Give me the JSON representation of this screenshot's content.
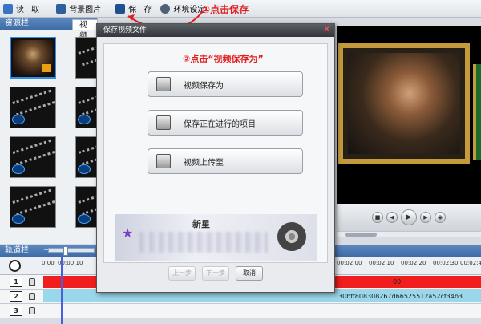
{
  "toolbar": {
    "read_label": "读 取",
    "bg_label": "背景图片",
    "save_label": "保 存",
    "env_label": "环境设定",
    "annotation1": "①点击保存"
  },
  "resource_panel": {
    "title": "资源栏",
    "tab": "视 频"
  },
  "dialog": {
    "title": "保存视频文件",
    "close": "x",
    "annotation2": "②点击“视频保存为”",
    "options": [
      {
        "label": "视频保存为"
      },
      {
        "label": "保存正在进行的项目"
      },
      {
        "label": "视频上传至"
      }
    ],
    "promo_title": "新星",
    "buttons": {
      "prev": "上一步",
      "next": "下一步",
      "cancel": "取消"
    }
  },
  "track_panel": {
    "title": "轨道栏",
    "ruler": [
      "0:00",
      "00:00:10",
      "00:02:00",
      "00:02:10",
      "00:02:20",
      "00:02:30",
      "00:02:40"
    ],
    "tracks": [
      {
        "num": "1",
        "text": "00"
      },
      {
        "num": "2",
        "text": "30bff808308267d66525512a52cf34b3"
      },
      {
        "num": "3",
        "text": ""
      }
    ]
  },
  "colors": {
    "accent": "#3d6aa4",
    "annotation": "#e02020",
    "track1": "#f21d1d",
    "track2": "#9ad7ea"
  }
}
